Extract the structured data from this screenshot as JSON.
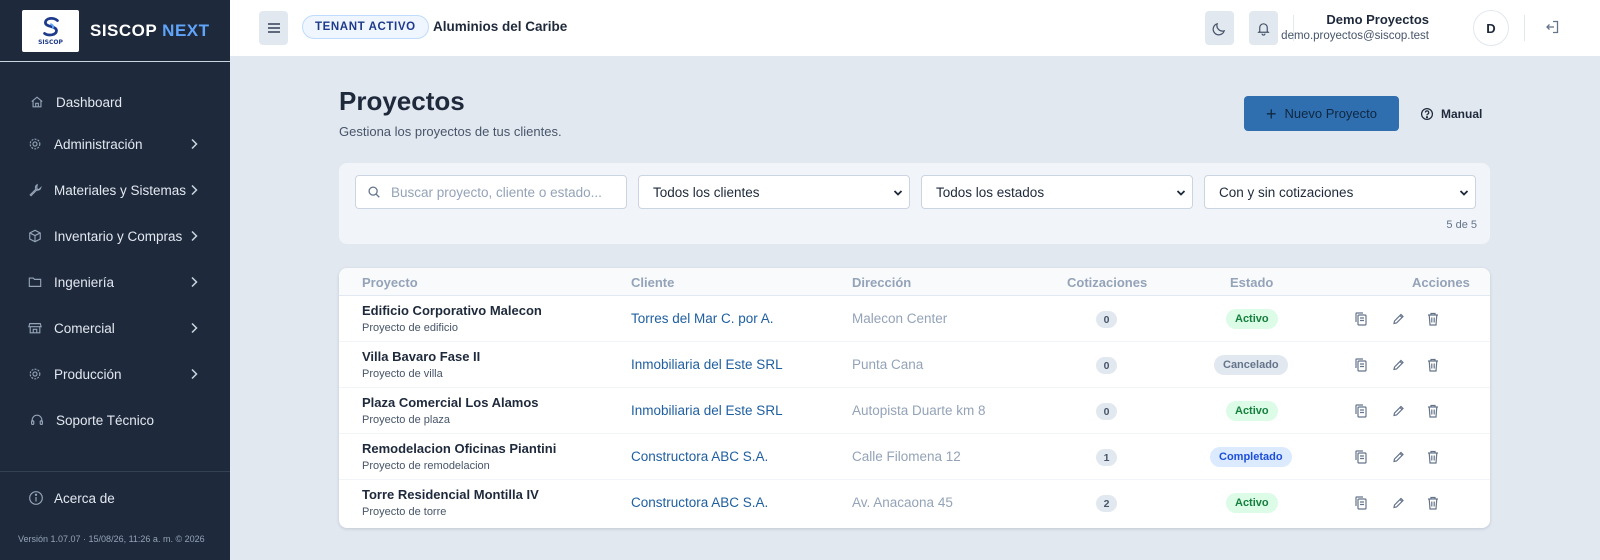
{
  "brand": {
    "name_main": "SISCOP",
    "name_accent": "NEXT",
    "logo_text": "SISCOP"
  },
  "sidebar": {
    "items": [
      {
        "label": "Dashboard",
        "icon": "home-icon",
        "expandable": false
      },
      {
        "label": "Administración",
        "icon": "gear-icon",
        "expandable": true
      },
      {
        "label": "Materiales y Sistemas",
        "icon": "wrench-icon",
        "expandable": true
      },
      {
        "label": "Inventario y Compras",
        "icon": "box-icon",
        "expandable": true
      },
      {
        "label": "Ingeniería",
        "icon": "folder-icon",
        "expandable": true
      },
      {
        "label": "Comercial",
        "icon": "store-icon",
        "expandable": true
      },
      {
        "label": "Producción",
        "icon": "gear-icon",
        "expandable": true
      },
      {
        "label": "Soporte Técnico",
        "icon": "headset-icon",
        "expandable": false
      }
    ],
    "about": "Acerca de",
    "version": "Versión 1.07.07 · 15/08/26, 11:26 a. m. © 2026"
  },
  "header": {
    "tenant_badge": "TENANT ACTIVO",
    "tenant_name": "Aluminios del Caribe",
    "user_name": "Demo Proyectos",
    "user_email": "demo.proyectos@siscop.test",
    "avatar_initial": "D"
  },
  "page": {
    "title": "Proyectos",
    "subtitle": "Gestiona los proyectos de tus clientes.",
    "new_button": "Nuevo Proyecto",
    "manual_button": "Manual"
  },
  "filters": {
    "search_placeholder": "Buscar proyecto, cliente o estado...",
    "client_select": "Todos los clientes",
    "status_select": "Todos los estados",
    "quotes_select": "Con y sin cotizaciones",
    "count": "5 de 5"
  },
  "table": {
    "headers": {
      "project": "Proyecto",
      "client": "Cliente",
      "address": "Dirección",
      "quotes": "Cotizaciones",
      "status": "Estado",
      "actions": "Acciones"
    },
    "rows": [
      {
        "name": "Edificio Corporativo Malecon",
        "desc": "Proyecto de edificio",
        "client": "Torres del Mar C. por A.",
        "address": "Malecon Center",
        "quotes": "0",
        "status": "Activo",
        "status_kind": "active"
      },
      {
        "name": "Villa Bavaro Fase II",
        "desc": "Proyecto de villa",
        "client": "Inmobiliaria del Este SRL",
        "address": "Punta Cana",
        "quotes": "0",
        "status": "Cancelado",
        "status_kind": "cancelled"
      },
      {
        "name": "Plaza Comercial Los Alamos",
        "desc": "Proyecto de plaza",
        "client": "Inmobiliaria del Este SRL",
        "address": "Autopista Duarte km 8",
        "quotes": "0",
        "status": "Activo",
        "status_kind": "active"
      },
      {
        "name": "Remodelacion Oficinas Piantini",
        "desc": "Proyecto de remodelacion",
        "client": "Constructora ABC S.A.",
        "address": "Calle Filomena 12",
        "quotes": "1",
        "status": "Completado",
        "status_kind": "completed"
      },
      {
        "name": "Torre Residencial Montilla IV",
        "desc": "Proyecto de torre",
        "client": "Constructora ABC S.A.",
        "address": "Av. Anacaona 45",
        "quotes": "2",
        "status": "Activo",
        "status_kind": "active"
      }
    ]
  },
  "colors": {
    "sidebar_bg": "#1e293b",
    "accent": "#2f6fb0",
    "status_active_bg": "#dcfce7",
    "status_active_fg": "#15803d",
    "status_cancelled_bg": "#e2e8f0",
    "status_cancelled_fg": "#64748b",
    "status_completed_bg": "#dbeafe",
    "status_completed_fg": "#1d4ed8"
  }
}
